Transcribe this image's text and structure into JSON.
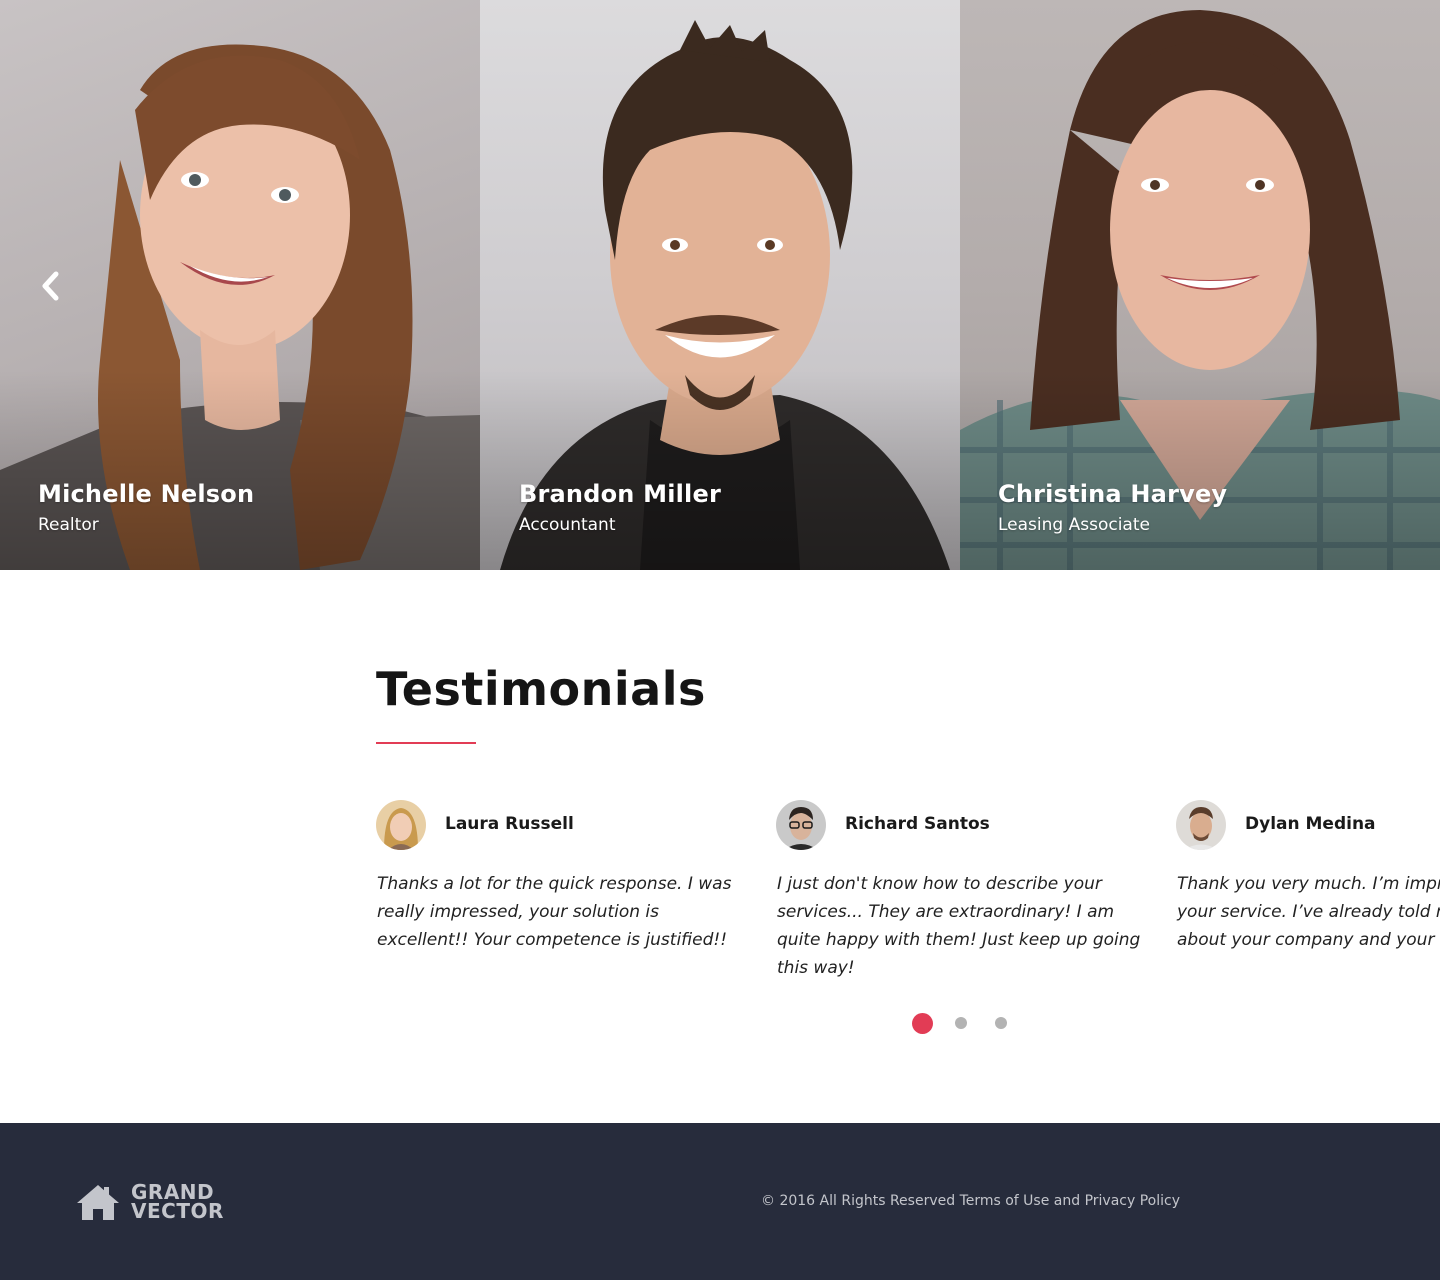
{
  "team": {
    "members": [
      {
        "name": "Michelle Nelson",
        "role": "Realtor"
      },
      {
        "name": "Brandon Miller",
        "role": "Accountant"
      },
      {
        "name": "Christina Harvey",
        "role": "Leasing Associate"
      }
    ]
  },
  "testimonials": {
    "title": "Testimonials",
    "items": [
      {
        "name": "Laura Russell",
        "quote": "Thanks a lot for the quick response. I was really impressed, your solution is excellent!! Your competence is justified!!"
      },
      {
        "name": "Richard Santos",
        "quote": "I just don't know how to describe your services... They are extraordinary! I am quite happy with them! Just keep up going this way!"
      },
      {
        "name": "Dylan Medina",
        "quote": "Thank you very much. I’m impressed with your service. I’ve already told my friends about your company and your quick response,"
      }
    ],
    "active_slide": 1,
    "slide_count": 3
  },
  "footer": {
    "logo_line1": "GRAND",
    "logo_line2": "VECTOR",
    "copyright": "© 2016 All Rights Reserved",
    "terms_label": "Terms of Use",
    "and_text": "and",
    "privacy_label": "Privacy Policy"
  },
  "colors": {
    "accent": "#e23c55",
    "footer_bg": "#272c3c",
    "dot_inactive": "#b3b3b3"
  },
  "icons": {
    "prev": "chevron-left-icon",
    "logo": "house-icon"
  }
}
